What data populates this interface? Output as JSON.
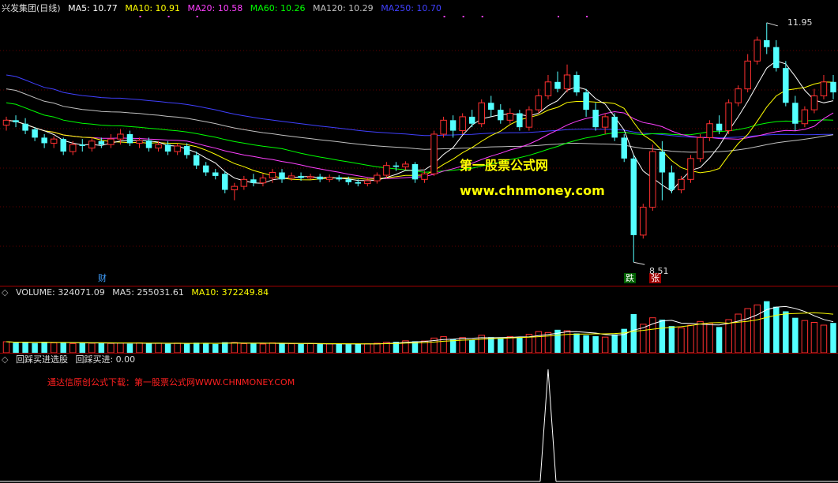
{
  "kline_header": {
    "title": "兴发集团(日线)",
    "ma5": "MA5: 10.77",
    "ma10": "MA10: 10.91",
    "ma20": "MA20: 10.58",
    "ma60": "MA60: 10.26",
    "ma120": "MA120: 10.29",
    "ma250": "MA250: 10.70",
    "colors": {
      "title": "#dddddd",
      "ma5": "#ffffff",
      "ma10": "#ffff00",
      "ma20": "#ff40ff",
      "ma60": "#00ff00",
      "ma120": "#c0c0c0",
      "ma250": "#4040ff"
    }
  },
  "price_labels": {
    "high": "11.95",
    "low": "8.51"
  },
  "event_tags": {
    "cai": "财",
    "die": "跌",
    "zhang": "张"
  },
  "watermark": {
    "line1": "第一股票公式网",
    "line2": "www.chnmoney.com"
  },
  "volume_header": {
    "volume": "VOLUME: 324071.09",
    "ma5": "MA5: 255031.61",
    "ma10": "MA10: 372249.84",
    "colors": {
      "volume": "#dddddd",
      "ma5": "#dddddd",
      "ma10": "#ffff00"
    }
  },
  "indicator_header": {
    "name": "回踩买进选股",
    "value": "回踩买进: 0.00"
  },
  "promo_text": "通达信原创公式下载：第一股票公式网WWW.CHNMONEY.COM",
  "chart_data": [
    {
      "type": "candlestick",
      "title": "兴发集团(日线)",
      "series": [
        {
          "name": "MA5",
          "color": "#ffffff",
          "last": 10.77
        },
        {
          "name": "MA10",
          "color": "#ffff00",
          "last": 10.91
        },
        {
          "name": "MA20",
          "color": "#ff40ff",
          "last": 10.58
        },
        {
          "name": "MA60",
          "color": "#00ff00",
          "last": 10.26
        },
        {
          "name": "MA120",
          "color": "#c0c0c0",
          "last": 10.29
        },
        {
          "name": "MA250",
          "color": "#4040ff",
          "last": 10.7
        }
      ],
      "annotations": {
        "max": 11.95,
        "min": 8.51
      },
      "candles": [
        [
          10.48,
          10.55,
          10.4,
          10.6
        ],
        [
          10.55,
          10.52,
          10.45,
          10.62
        ],
        [
          10.5,
          10.4,
          10.35,
          10.58
        ],
        [
          10.42,
          10.3,
          10.25,
          10.45
        ],
        [
          10.3,
          10.22,
          10.15,
          10.35
        ],
        [
          10.22,
          10.28,
          10.15,
          10.32
        ],
        [
          10.28,
          10.1,
          10.05,
          10.3
        ],
        [
          10.1,
          10.2,
          10.05,
          10.25
        ],
        [
          10.2,
          10.18,
          10.1,
          10.28
        ],
        [
          10.15,
          10.25,
          10.1,
          10.3
        ],
        [
          10.25,
          10.2,
          10.15,
          10.3
        ],
        [
          10.2,
          10.28,
          10.15,
          10.35
        ],
        [
          10.28,
          10.35,
          10.2,
          10.42
        ],
        [
          10.35,
          10.22,
          10.18,
          10.4
        ],
        [
          10.22,
          10.26,
          10.15,
          10.3
        ],
        [
          10.26,
          10.15,
          10.1,
          10.3
        ],
        [
          10.15,
          10.2,
          10.1,
          10.25
        ],
        [
          10.2,
          10.1,
          10.05,
          10.25
        ],
        [
          10.1,
          10.18,
          10.05,
          10.22
        ],
        [
          10.18,
          10.05,
          10.0,
          10.22
        ],
        [
          10.05,
          9.9,
          9.85,
          10.1
        ],
        [
          9.9,
          9.8,
          9.75,
          9.95
        ],
        [
          9.8,
          9.75,
          9.7,
          9.85
        ],
        [
          9.78,
          9.55,
          9.5,
          9.82
        ],
        [
          9.55,
          9.6,
          9.4,
          9.65
        ],
        [
          9.6,
          9.7,
          9.55,
          9.75
        ],
        [
          9.7,
          9.65,
          9.6,
          9.78
        ],
        [
          9.65,
          9.72,
          9.6,
          9.78
        ],
        [
          9.72,
          9.8,
          9.65,
          9.85
        ],
        [
          9.8,
          9.7,
          9.65,
          9.85
        ],
        [
          9.72,
          9.75,
          9.68,
          9.8
        ],
        [
          9.75,
          9.72,
          9.68,
          9.8
        ],
        [
          9.72,
          9.74,
          9.7,
          9.78
        ],
        [
          9.74,
          9.7,
          9.66,
          9.78
        ],
        [
          9.7,
          9.73,
          9.66,
          9.77
        ],
        [
          9.73,
          9.7,
          9.67,
          9.76
        ],
        [
          9.7,
          9.66,
          9.62,
          9.74
        ],
        [
          9.66,
          9.64,
          9.6,
          9.7
        ],
        [
          9.64,
          9.68,
          9.6,
          9.72
        ],
        [
          9.68,
          9.76,
          9.64,
          9.8
        ],
        [
          9.76,
          9.9,
          9.72,
          9.95
        ],
        [
          9.9,
          9.88,
          9.82,
          9.95
        ],
        [
          9.88,
          9.92,
          9.84,
          9.96
        ],
        [
          9.92,
          9.7,
          9.65,
          9.95
        ],
        [
          9.7,
          9.78,
          9.65,
          9.82
        ],
        [
          9.78,
          10.35,
          9.75,
          10.4
        ],
        [
          10.35,
          10.55,
          10.3,
          10.6
        ],
        [
          10.55,
          10.4,
          10.3,
          10.62
        ],
        [
          10.4,
          10.6,
          10.35,
          10.65
        ],
        [
          10.6,
          10.5,
          10.45,
          10.7
        ],
        [
          10.5,
          10.8,
          10.45,
          10.85
        ],
        [
          10.8,
          10.7,
          10.6,
          10.9
        ],
        [
          10.7,
          10.55,
          10.5,
          10.78
        ],
        [
          10.55,
          10.65,
          10.5,
          10.72
        ],
        [
          10.65,
          10.45,
          10.4,
          10.7
        ],
        [
          10.45,
          10.7,
          10.4,
          10.75
        ],
        [
          10.7,
          10.9,
          10.65,
          11.0
        ],
        [
          10.9,
          11.1,
          10.85,
          11.2
        ],
        [
          11.1,
          11.0,
          10.95,
          11.25
        ],
        [
          11.0,
          11.2,
          10.95,
          11.35
        ],
        [
          11.2,
          10.95,
          10.9,
          11.25
        ],
        [
          10.95,
          10.7,
          10.6,
          11.0
        ],
        [
          10.7,
          10.45,
          10.4,
          10.8
        ],
        [
          10.45,
          10.6,
          10.35,
          10.65
        ],
        [
          10.6,
          10.3,
          10.25,
          10.65
        ],
        [
          10.3,
          10.0,
          9.95,
          10.35
        ],
        [
          10.0,
          8.9,
          8.51,
          10.05
        ],
        [
          8.9,
          9.3,
          8.85,
          9.35
        ],
        [
          9.3,
          10.1,
          9.25,
          10.2
        ],
        [
          10.1,
          9.8,
          9.4,
          10.25
        ],
        [
          9.8,
          9.55,
          9.5,
          9.9
        ],
        [
          9.55,
          9.7,
          9.5,
          9.75
        ],
        [
          9.7,
          10.0,
          9.65,
          10.05
        ],
        [
          10.0,
          10.3,
          9.95,
          10.35
        ],
        [
          10.3,
          10.5,
          10.25,
          10.55
        ],
        [
          10.5,
          10.4,
          10.35,
          10.62
        ],
        [
          10.4,
          10.8,
          10.35,
          10.85
        ],
        [
          10.8,
          11.0,
          10.75,
          11.05
        ],
        [
          11.0,
          11.4,
          10.95,
          11.5
        ],
        [
          11.4,
          11.7,
          11.35,
          11.75
        ],
        [
          11.7,
          11.6,
          11.5,
          11.95
        ],
        [
          11.6,
          11.3,
          11.25,
          11.7
        ],
        [
          11.3,
          10.8,
          10.75,
          11.4
        ],
        [
          10.8,
          10.5,
          10.4,
          10.9
        ],
        [
          10.5,
          10.7,
          10.45,
          10.75
        ],
        [
          10.7,
          10.9,
          10.65,
          11.0
        ],
        [
          10.9,
          11.1,
          10.85,
          11.2
        ],
        [
          11.1,
          10.95,
          10.85,
          11.2
        ]
      ]
    },
    {
      "type": "bar",
      "title": "VOLUME",
      "series": [
        {
          "name": "VOLUME",
          "last": 324071.09
        },
        {
          "name": "MA5",
          "last": 255031.61
        },
        {
          "name": "MA10",
          "last": 372249.84
        }
      ],
      "values": [
        120000,
        110000,
        115000,
        105000,
        118000,
        108000,
        112000,
        100000,
        109000,
        104000,
        111000,
        102000,
        106000,
        99000,
        108000,
        101000,
        103000,
        97000,
        105000,
        98000,
        110000,
        107000,
        96000,
        115000,
        112000,
        99000,
        101000,
        95000,
        108000,
        100000,
        98000,
        96000,
        99000,
        94000,
        97000,
        95000,
        93000,
        96000,
        98000,
        104000,
        115000,
        120000,
        130000,
        125000,
        128000,
        160000,
        175000,
        150000,
        165000,
        140000,
        190000,
        170000,
        160000,
        175000,
        165000,
        200000,
        230000,
        220000,
        250000,
        240000,
        210000,
        190000,
        180000,
        170000,
        200000,
        260000,
        420000,
        310000,
        380000,
        360000,
        290000,
        270000,
        300000,
        340000,
        320000,
        280000,
        360000,
        420000,
        480000,
        520000,
        560000,
        500000,
        450000,
        380000,
        350000,
        330000,
        300000,
        324071
      ]
    },
    {
      "type": "line",
      "title": "回踩买进选股",
      "series": [
        {
          "name": "回踩买进",
          "last": 0.0
        }
      ],
      "signal_index": 57,
      "signal_value": 1
    }
  ]
}
